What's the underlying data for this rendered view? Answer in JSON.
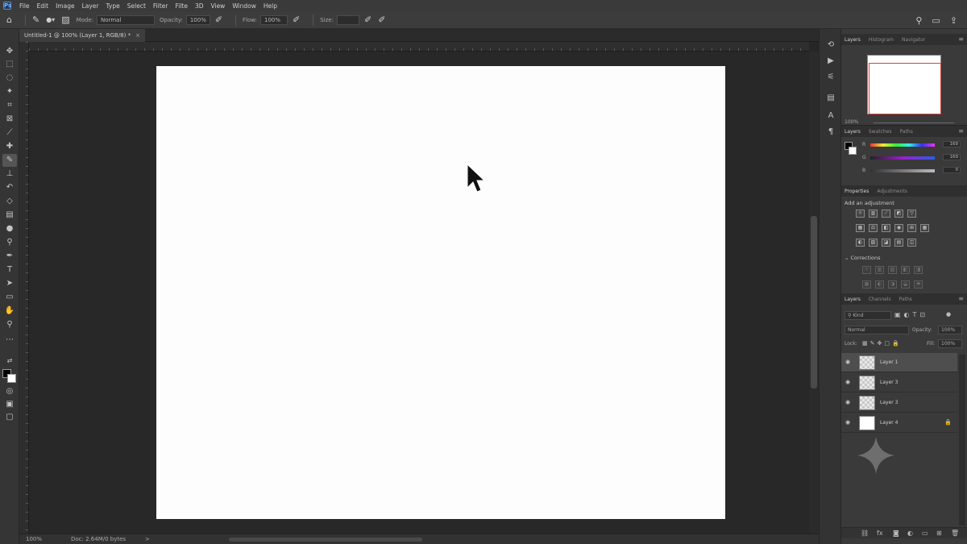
{
  "menu": {
    "logo": "Ps",
    "items": [
      "File",
      "Edit",
      "Image",
      "Layer",
      "Type",
      "Select",
      "Filter",
      "Filte",
      "3D",
      "View",
      "Window",
      "Help"
    ]
  },
  "options": {
    "mode_label": "Mode:",
    "mode_value": "Normal",
    "opacity_label": "Opacity:",
    "opacity_value": "100%",
    "flow_label": "Flow:",
    "flow_value": "100%",
    "size_label": "Size:"
  },
  "document": {
    "tab_title": "Untitled-1 @ 100% (Layer 1, RGB/8) *",
    "close_glyph": "×"
  },
  "status": {
    "zoom": "100%",
    "info": "Doc: 2.64M/0 bytes",
    "arrow": ">"
  },
  "navigator": {
    "tabs": [
      "Layers",
      "Histogram",
      "Navigator"
    ],
    "zoom": "100%"
  },
  "color": {
    "tabs": [
      "Layers",
      "Swatches",
      "Paths"
    ],
    "rows": [
      {
        "label": "R",
        "value": "169"
      },
      {
        "label": "G",
        "value": "169"
      },
      {
        "label": "B",
        "value": "0"
      }
    ]
  },
  "adjustments": {
    "tabs": [
      "Properties",
      "Adjustments"
    ],
    "add_label": "Add an adjustment",
    "section2_label": "Corrections"
  },
  "layers": {
    "tabs": [
      "Layers",
      "Channels",
      "Paths"
    ],
    "kind_label": "Kind",
    "blend_mode": "Normal",
    "opacity_label": "Opacity:",
    "opacity_value": "100%",
    "lock_label": "Lock:",
    "fill_label": "Fill:",
    "fill_value": "100%",
    "items": [
      {
        "name": "Layer 1",
        "selected": true,
        "locked": false
      },
      {
        "name": "Layer 3",
        "selected": false,
        "locked": false
      },
      {
        "name": "Layer 3",
        "selected": false,
        "locked": false
      },
      {
        "name": "Layer 4",
        "selected": false,
        "locked": true
      }
    ]
  },
  "colors": {
    "canvas": "#fdfdfd",
    "pasteboard": "#282828",
    "panel": "#3a3a3a",
    "accent_red": "#d9413a"
  }
}
